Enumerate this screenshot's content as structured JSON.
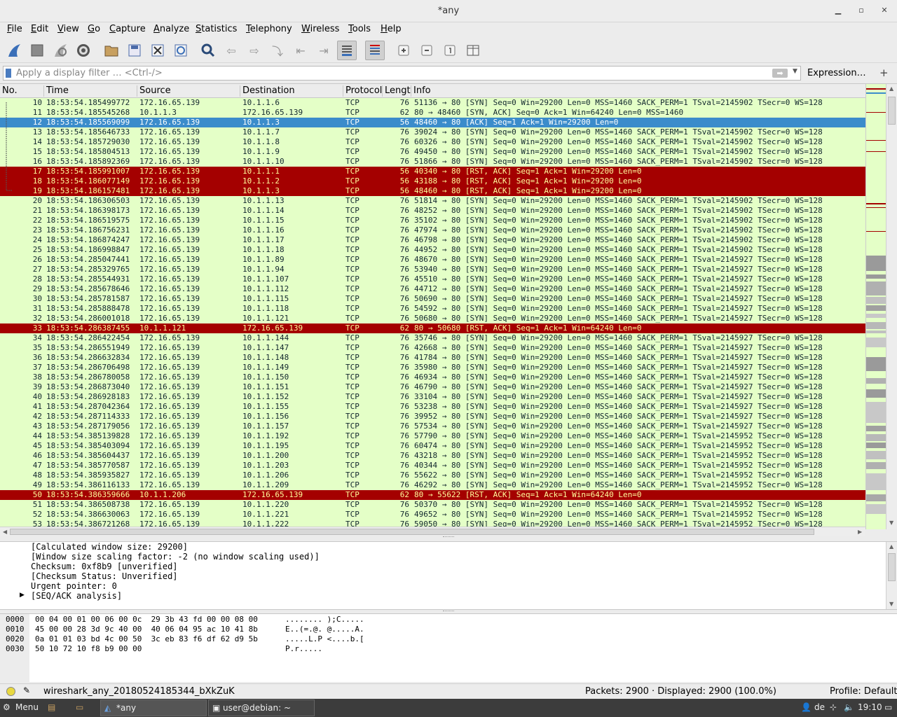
{
  "window": {
    "title": "*any",
    "minimize_icon": "minimize",
    "maximize_icon": "maximize",
    "close_icon": "close"
  },
  "menu": [
    "File",
    "Edit",
    "View",
    "Go",
    "Capture",
    "Analyze",
    "Statistics",
    "Telephony",
    "Wireless",
    "Tools",
    "Help"
  ],
  "toolbar": {
    "icons": [
      "shark-fin-start-icon",
      "stop-icon",
      "restart-icon",
      "capture-options-icon",
      "open-folder-icon",
      "save-icon",
      "close-file-icon",
      "reload-icon",
      "find-icon",
      "go-back-icon",
      "go-forward-icon",
      "go-to-packet-icon",
      "first-packet-icon",
      "last-packet-icon",
      "autoscroll-icon",
      "colorize-icon",
      "zoom-in-icon",
      "zoom-out-icon",
      "normal-size-icon",
      "resize-columns-icon"
    ]
  },
  "filter": {
    "placeholder": "Apply a display filter … <Ctrl-/>",
    "value": "",
    "expression_label": "Expression…",
    "plus_label": "+"
  },
  "columns": [
    "No.",
    "Time",
    "Source",
    "Destination",
    "Protocol",
    "Lengtl",
    "Info"
  ],
  "packets": [
    {
      "no": "10",
      "time": "18:53:54.185499772",
      "src": "172.16.65.139",
      "dst": "10.1.1.6",
      "proto": "TCP",
      "len": "76",
      "info": "51136 → 80 [SYN] Seq=0 Win=29200 Len=0 MSS=1460 SACK_PERM=1 TSval=2145902 TSecr=0 WS=128",
      "style": "normal"
    },
    {
      "no": "11",
      "time": "18:53:54.185545268",
      "src": "10.1.1.3",
      "dst": "172.16.65.139",
      "proto": "TCP",
      "len": "62",
      "info": "80 → 48460 [SYN, ACK] Seq=0 Ack=1 Win=64240 Len=0 MSS=1460",
      "style": "normal"
    },
    {
      "no": "12",
      "time": "18:53:54.185569099",
      "src": "172.16.65.139",
      "dst": "10.1.1.3",
      "proto": "TCP",
      "len": "56",
      "info": "48460 → 80 [ACK] Seq=1 Ack=1 Win=29200 Len=0",
      "style": "selected"
    },
    {
      "no": "13",
      "time": "18:53:54.185646733",
      "src": "172.16.65.139",
      "dst": "10.1.1.7",
      "proto": "TCP",
      "len": "76",
      "info": "39024 → 80 [SYN] Seq=0 Win=29200 Len=0 MSS=1460 SACK_PERM=1 TSval=2145902 TSecr=0 WS=128",
      "style": "normal"
    },
    {
      "no": "14",
      "time": "18:53:54.185729030",
      "src": "172.16.65.139",
      "dst": "10.1.1.8",
      "proto": "TCP",
      "len": "76",
      "info": "60326 → 80 [SYN] Seq=0 Win=29200 Len=0 MSS=1460 SACK_PERM=1 TSval=2145902 TSecr=0 WS=128",
      "style": "normal"
    },
    {
      "no": "15",
      "time": "18:53:54.185804513",
      "src": "172.16.65.139",
      "dst": "10.1.1.9",
      "proto": "TCP",
      "len": "76",
      "info": "49450 → 80 [SYN] Seq=0 Win=29200 Len=0 MSS=1460 SACK_PERM=1 TSval=2145902 TSecr=0 WS=128",
      "style": "normal"
    },
    {
      "no": "16",
      "time": "18:53:54.185892369",
      "src": "172.16.65.139",
      "dst": "10.1.1.10",
      "proto": "TCP",
      "len": "76",
      "info": "51866 → 80 [SYN] Seq=0 Win=29200 Len=0 MSS=1460 SACK_PERM=1 TSval=2145902 TSecr=0 WS=128",
      "style": "normal"
    },
    {
      "no": "17",
      "time": "18:53:54.185991007",
      "src": "172.16.65.139",
      "dst": "10.1.1.1",
      "proto": "TCP",
      "len": "56",
      "info": "40340 → 80 [RST, ACK] Seq=1 Ack=1 Win=29200 Len=0",
      "style": "rst"
    },
    {
      "no": "18",
      "time": "18:53:54.186077149",
      "src": "172.16.65.139",
      "dst": "10.1.1.2",
      "proto": "TCP",
      "len": "56",
      "info": "43188 → 80 [RST, ACK] Seq=1 Ack=1 Win=29200 Len=0",
      "style": "rst"
    },
    {
      "no": "19",
      "time": "18:53:54.186157481",
      "src": "172.16.65.139",
      "dst": "10.1.1.3",
      "proto": "TCP",
      "len": "56",
      "info": "48460 → 80 [RST, ACK] Seq=1 Ack=1 Win=29200 Len=0",
      "style": "rst"
    },
    {
      "no": "20",
      "time": "18:53:54.186306503",
      "src": "172.16.65.139",
      "dst": "10.1.1.13",
      "proto": "TCP",
      "len": "76",
      "info": "51814 → 80 [SYN] Seq=0 Win=29200 Len=0 MSS=1460 SACK_PERM=1 TSval=2145902 TSecr=0 WS=128",
      "style": "normal"
    },
    {
      "no": "21",
      "time": "18:53:54.186398173",
      "src": "172.16.65.139",
      "dst": "10.1.1.14",
      "proto": "TCP",
      "len": "76",
      "info": "48252 → 80 [SYN] Seq=0 Win=29200 Len=0 MSS=1460 SACK_PERM=1 TSval=2145902 TSecr=0 WS=128",
      "style": "normal"
    },
    {
      "no": "22",
      "time": "18:53:54.186519575",
      "src": "172.16.65.139",
      "dst": "10.1.1.15",
      "proto": "TCP",
      "len": "76",
      "info": "35102 → 80 [SYN] Seq=0 Win=29200 Len=0 MSS=1460 SACK_PERM=1 TSval=2145902 TSecr=0 WS=128",
      "style": "normal"
    },
    {
      "no": "23",
      "time": "18:53:54.186756231",
      "src": "172.16.65.139",
      "dst": "10.1.1.16",
      "proto": "TCP",
      "len": "76",
      "info": "47974 → 80 [SYN] Seq=0 Win=29200 Len=0 MSS=1460 SACK_PERM=1 TSval=2145902 TSecr=0 WS=128",
      "style": "normal"
    },
    {
      "no": "24",
      "time": "18:53:54.186874247",
      "src": "172.16.65.139",
      "dst": "10.1.1.17",
      "proto": "TCP",
      "len": "76",
      "info": "46798 → 80 [SYN] Seq=0 Win=29200 Len=0 MSS=1460 SACK_PERM=1 TSval=2145902 TSecr=0 WS=128",
      "style": "normal"
    },
    {
      "no": "25",
      "time": "18:53:54.186998847",
      "src": "172.16.65.139",
      "dst": "10.1.1.18",
      "proto": "TCP",
      "len": "76",
      "info": "44952 → 80 [SYN] Seq=0 Win=29200 Len=0 MSS=1460 SACK_PERM=1 TSval=2145902 TSecr=0 WS=128",
      "style": "normal"
    },
    {
      "no": "26",
      "time": "18:53:54.285047441",
      "src": "172.16.65.139",
      "dst": "10.1.1.89",
      "proto": "TCP",
      "len": "76",
      "info": "48670 → 80 [SYN] Seq=0 Win=29200 Len=0 MSS=1460 SACK_PERM=1 TSval=2145927 TSecr=0 WS=128",
      "style": "normal"
    },
    {
      "no": "27",
      "time": "18:53:54.285329765",
      "src": "172.16.65.139",
      "dst": "10.1.1.94",
      "proto": "TCP",
      "len": "76",
      "info": "53940 → 80 [SYN] Seq=0 Win=29200 Len=0 MSS=1460 SACK_PERM=1 TSval=2145927 TSecr=0 WS=128",
      "style": "normal"
    },
    {
      "no": "28",
      "time": "18:53:54.285544931",
      "src": "172.16.65.139",
      "dst": "10.1.1.107",
      "proto": "TCP",
      "len": "76",
      "info": "45510 → 80 [SYN] Seq=0 Win=29200 Len=0 MSS=1460 SACK_PERM=1 TSval=2145927 TSecr=0 WS=128",
      "style": "normal"
    },
    {
      "no": "29",
      "time": "18:53:54.285678646",
      "src": "172.16.65.139",
      "dst": "10.1.1.112",
      "proto": "TCP",
      "len": "76",
      "info": "44712 → 80 [SYN] Seq=0 Win=29200 Len=0 MSS=1460 SACK_PERM=1 TSval=2145927 TSecr=0 WS=128",
      "style": "normal"
    },
    {
      "no": "30",
      "time": "18:53:54.285781587",
      "src": "172.16.65.139",
      "dst": "10.1.1.115",
      "proto": "TCP",
      "len": "76",
      "info": "50690 → 80 [SYN] Seq=0 Win=29200 Len=0 MSS=1460 SACK_PERM=1 TSval=2145927 TSecr=0 WS=128",
      "style": "normal"
    },
    {
      "no": "31",
      "time": "18:53:54.285888478",
      "src": "172.16.65.139",
      "dst": "10.1.1.118",
      "proto": "TCP",
      "len": "76",
      "info": "54592 → 80 [SYN] Seq=0 Win=29200 Len=0 MSS=1460 SACK_PERM=1 TSval=2145927 TSecr=0 WS=128",
      "style": "normal"
    },
    {
      "no": "32",
      "time": "18:53:54.286001018",
      "src": "172.16.65.139",
      "dst": "10.1.1.121",
      "proto": "TCP",
      "len": "76",
      "info": "50680 → 80 [SYN] Seq=0 Win=29200 Len=0 MSS=1460 SACK_PERM=1 TSval=2145927 TSecr=0 WS=128",
      "style": "normal"
    },
    {
      "no": "33",
      "time": "18:53:54.286387455",
      "src": "10.1.1.121",
      "dst": "172.16.65.139",
      "proto": "TCP",
      "len": "62",
      "info": "80 → 50680 [RST, ACK] Seq=1 Ack=1 Win=64240 Len=0",
      "style": "rst"
    },
    {
      "no": "34",
      "time": "18:53:54.286422454",
      "src": "172.16.65.139",
      "dst": "10.1.1.144",
      "proto": "TCP",
      "len": "76",
      "info": "35746 → 80 [SYN] Seq=0 Win=29200 Len=0 MSS=1460 SACK_PERM=1 TSval=2145927 TSecr=0 WS=128",
      "style": "normal"
    },
    {
      "no": "35",
      "time": "18:53:54.286551949",
      "src": "172.16.65.139",
      "dst": "10.1.1.147",
      "proto": "TCP",
      "len": "76",
      "info": "42668 → 80 [SYN] Seq=0 Win=29200 Len=0 MSS=1460 SACK_PERM=1 TSval=2145927 TSecr=0 WS=128",
      "style": "normal"
    },
    {
      "no": "36",
      "time": "18:53:54.286632834",
      "src": "172.16.65.139",
      "dst": "10.1.1.148",
      "proto": "TCP",
      "len": "76",
      "info": "41784 → 80 [SYN] Seq=0 Win=29200 Len=0 MSS=1460 SACK_PERM=1 TSval=2145927 TSecr=0 WS=128",
      "style": "normal"
    },
    {
      "no": "37",
      "time": "18:53:54.286706498",
      "src": "172.16.65.139",
      "dst": "10.1.1.149",
      "proto": "TCP",
      "len": "76",
      "info": "35980 → 80 [SYN] Seq=0 Win=29200 Len=0 MSS=1460 SACK_PERM=1 TSval=2145927 TSecr=0 WS=128",
      "style": "normal"
    },
    {
      "no": "38",
      "time": "18:53:54.286780058",
      "src": "172.16.65.139",
      "dst": "10.1.1.150",
      "proto": "TCP",
      "len": "76",
      "info": "46934 → 80 [SYN] Seq=0 Win=29200 Len=0 MSS=1460 SACK_PERM=1 TSval=2145927 TSecr=0 WS=128",
      "style": "normal"
    },
    {
      "no": "39",
      "time": "18:53:54.286873040",
      "src": "172.16.65.139",
      "dst": "10.1.1.151",
      "proto": "TCP",
      "len": "76",
      "info": "46790 → 80 [SYN] Seq=0 Win=29200 Len=0 MSS=1460 SACK_PERM=1 TSval=2145927 TSecr=0 WS=128",
      "style": "normal"
    },
    {
      "no": "40",
      "time": "18:53:54.286928183",
      "src": "172.16.65.139",
      "dst": "10.1.1.152",
      "proto": "TCP",
      "len": "76",
      "info": "33104 → 80 [SYN] Seq=0 Win=29200 Len=0 MSS=1460 SACK_PERM=1 TSval=2145927 TSecr=0 WS=128",
      "style": "normal"
    },
    {
      "no": "41",
      "time": "18:53:54.287042364",
      "src": "172.16.65.139",
      "dst": "10.1.1.155",
      "proto": "TCP",
      "len": "76",
      "info": "53238 → 80 [SYN] Seq=0 Win=29200 Len=0 MSS=1460 SACK_PERM=1 TSval=2145927 TSecr=0 WS=128",
      "style": "normal"
    },
    {
      "no": "42",
      "time": "18:53:54.287114333",
      "src": "172.16.65.139",
      "dst": "10.1.1.156",
      "proto": "TCP",
      "len": "76",
      "info": "39952 → 80 [SYN] Seq=0 Win=29200 Len=0 MSS=1460 SACK_PERM=1 TSval=2145927 TSecr=0 WS=128",
      "style": "normal"
    },
    {
      "no": "43",
      "time": "18:53:54.287179056",
      "src": "172.16.65.139",
      "dst": "10.1.1.157",
      "proto": "TCP",
      "len": "76",
      "info": "57534 → 80 [SYN] Seq=0 Win=29200 Len=0 MSS=1460 SACK_PERM=1 TSval=2145927 TSecr=0 WS=128",
      "style": "normal"
    },
    {
      "no": "44",
      "time": "18:53:54.385139828",
      "src": "172.16.65.139",
      "dst": "10.1.1.192",
      "proto": "TCP",
      "len": "76",
      "info": "57790 → 80 [SYN] Seq=0 Win=29200 Len=0 MSS=1460 SACK_PERM=1 TSval=2145952 TSecr=0 WS=128",
      "style": "normal"
    },
    {
      "no": "45",
      "time": "18:53:54.385403094",
      "src": "172.16.65.139",
      "dst": "10.1.1.195",
      "proto": "TCP",
      "len": "76",
      "info": "60474 → 80 [SYN] Seq=0 Win=29200 Len=0 MSS=1460 SACK_PERM=1 TSval=2145952 TSecr=0 WS=128",
      "style": "normal"
    },
    {
      "no": "46",
      "time": "18:53:54.385604437",
      "src": "172.16.65.139",
      "dst": "10.1.1.200",
      "proto": "TCP",
      "len": "76",
      "info": "43218 → 80 [SYN] Seq=0 Win=29200 Len=0 MSS=1460 SACK_PERM=1 TSval=2145952 TSecr=0 WS=128",
      "style": "normal"
    },
    {
      "no": "47",
      "time": "18:53:54.385770587",
      "src": "172.16.65.139",
      "dst": "10.1.1.203",
      "proto": "TCP",
      "len": "76",
      "info": "40344 → 80 [SYN] Seq=0 Win=29200 Len=0 MSS=1460 SACK_PERM=1 TSval=2145952 TSecr=0 WS=128",
      "style": "normal"
    },
    {
      "no": "48",
      "time": "18:53:54.385935827",
      "src": "172.16.65.139",
      "dst": "10.1.1.206",
      "proto": "TCP",
      "len": "76",
      "info": "55622 → 80 [SYN] Seq=0 Win=29200 Len=0 MSS=1460 SACK_PERM=1 TSval=2145952 TSecr=0 WS=128",
      "style": "normal"
    },
    {
      "no": "49",
      "time": "18:53:54.386116133",
      "src": "172.16.65.139",
      "dst": "10.1.1.209",
      "proto": "TCP",
      "len": "76",
      "info": "46292 → 80 [SYN] Seq=0 Win=29200 Len=0 MSS=1460 SACK_PERM=1 TSval=2145952 TSecr=0 WS=128",
      "style": "normal"
    },
    {
      "no": "50",
      "time": "18:53:54.386359666",
      "src": "10.1.1.206",
      "dst": "172.16.65.139",
      "proto": "TCP",
      "len": "62",
      "info": "80 → 55622 [RST, ACK] Seq=1 Ack=1 Win=64240 Len=0",
      "style": "rst"
    },
    {
      "no": "51",
      "time": "18:53:54.386508738",
      "src": "172.16.65.139",
      "dst": "10.1.1.220",
      "proto": "TCP",
      "len": "76",
      "info": "50370 → 80 [SYN] Seq=0 Win=29200 Len=0 MSS=1460 SACK_PERM=1 TSval=2145952 TSecr=0 WS=128",
      "style": "normal"
    },
    {
      "no": "52",
      "time": "18:53:54.386630063",
      "src": "172.16.65.139",
      "dst": "10.1.1.221",
      "proto": "TCP",
      "len": "76",
      "info": "49652 → 80 [SYN] Seq=0 Win=29200 Len=0 MSS=1460 SACK_PERM=1 TSval=2145952 TSecr=0 WS=128",
      "style": "normal"
    },
    {
      "no": "53",
      "time": "18:53:54.386721268",
      "src": "172.16.65.139",
      "dst": "10.1.1.222",
      "proto": "TCP",
      "len": "76",
      "info": "59050 → 80 [SYN] Seq=0 Win=29200 Len=0 MSS=1460 SACK_PERM=1 TSval=2145952 TSecr=0 WS=128",
      "style": "normal"
    }
  ],
  "details": [
    {
      "text": "[Calculated window size: 29200]",
      "expandable": false
    },
    {
      "text": "[Window size scaling factor: -2 (no window scaling used)]",
      "expandable": false
    },
    {
      "text": "Checksum: 0xf8b9 [unverified]",
      "expandable": false
    },
    {
      "text": "[Checksum Status: Unverified]",
      "expandable": false
    },
    {
      "text": "Urgent pointer: 0",
      "expandable": false
    },
    {
      "text": "[SEQ/ACK analysis]",
      "expandable": true
    }
  ],
  "bytes": [
    {
      "offset": "0000",
      "hex": "00 04 00 01 00 06 00 0c  29 3b 43 fd 00 00 08 00",
      "ascii": "........ );C....."
    },
    {
      "offset": "0010",
      "hex": "45 00 00 28 3d 9c 40 00  40 06 04 95 ac 10 41 8b",
      "ascii": "E..(=.@. @.....A."
    },
    {
      "offset": "0020",
      "hex": "0a 01 01 03 bd 4c 00 50  3c eb 83 f6 df 62 d9 5b",
      "ascii": ".....L.P <....b.["
    },
    {
      "offset": "0030",
      "hex": "50 10 72 10 f8 b9 00 00",
      "ascii": "P.r....."
    }
  ],
  "status": {
    "file": "wireshark_any_20180524185344_bXkZuK",
    "packets": "Packets: 2900 · Displayed: 2900 (100.0%)",
    "profile": "Profile: Default"
  },
  "taskbar": {
    "menu_label": "Menu",
    "tasks": [
      {
        "label": "*any"
      },
      {
        "label": "user@debian: ~"
      }
    ],
    "keyboard_layout": "de",
    "clock": "19:10"
  },
  "colors": {
    "syn_row": "#e4ffc7",
    "rst_row": "#a40000",
    "selected_row": "#3b8ccb",
    "rst_text": "#fffc9c"
  }
}
